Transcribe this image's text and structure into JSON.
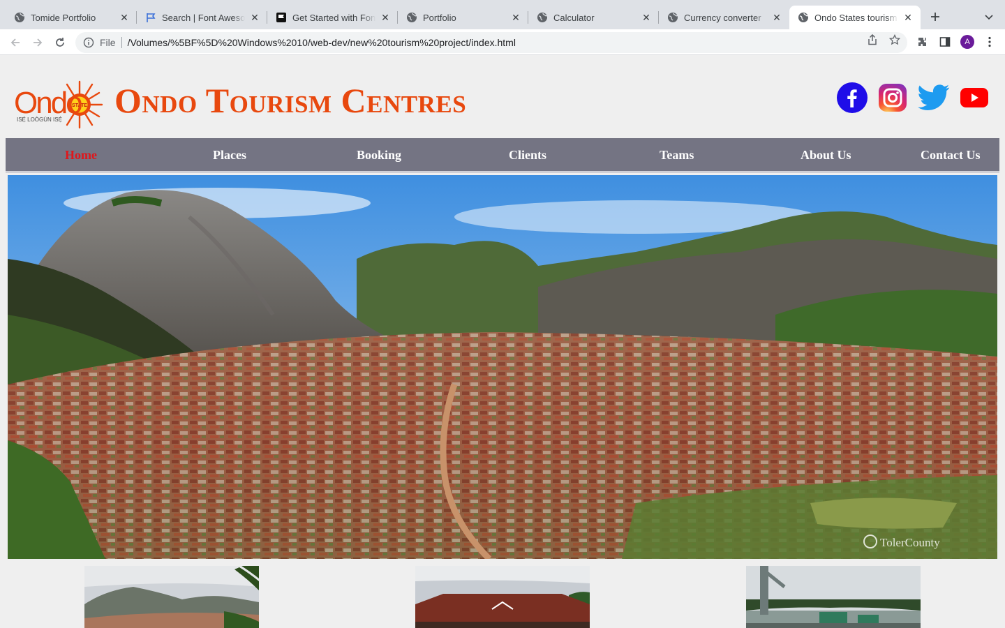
{
  "browser": {
    "tabs": [
      {
        "title": "Tomide Portfolio",
        "favicon": "globe-icon"
      },
      {
        "title": "Search | Font Awesome",
        "favicon": "flag-icon"
      },
      {
        "title": "Get Started with Font Awesome",
        "favicon": "font-awesome-icon"
      },
      {
        "title": "Portfolio",
        "favicon": "globe-icon"
      },
      {
        "title": "Calculator",
        "favicon": "globe-icon"
      },
      {
        "title": "Currency converter",
        "favicon": "globe-icon"
      },
      {
        "title": "Ondo States tourism centres",
        "favicon": "globe-icon",
        "active": true
      }
    ],
    "address": {
      "scheme_label": "File",
      "url": "/Volumes/%5BF%5D%20Windows%2010/web-dev/new%20tourism%20project/index.html"
    },
    "profile_initial": "A"
  },
  "site": {
    "logo": {
      "word": "Ondo",
      "badge": "STATE",
      "motto": "ISẸ́ LOÒGÙN ISẸ́"
    },
    "title": "Ondo Tourism Centres",
    "social": [
      "facebook-icon",
      "instagram-icon",
      "twitter-icon",
      "youtube-icon"
    ],
    "nav": [
      {
        "label": "Home",
        "active": true
      },
      {
        "label": "Places"
      },
      {
        "label": "Booking"
      },
      {
        "label": "Clients"
      },
      {
        "label": "Teams"
      },
      {
        "label": "About Us"
      },
      {
        "label": "Contact Us"
      }
    ],
    "hero_watermark": "TolerCounty",
    "colors": {
      "brand": "#e8480e",
      "nav_bg": "#747483",
      "nav_active": "#e0161b"
    }
  }
}
